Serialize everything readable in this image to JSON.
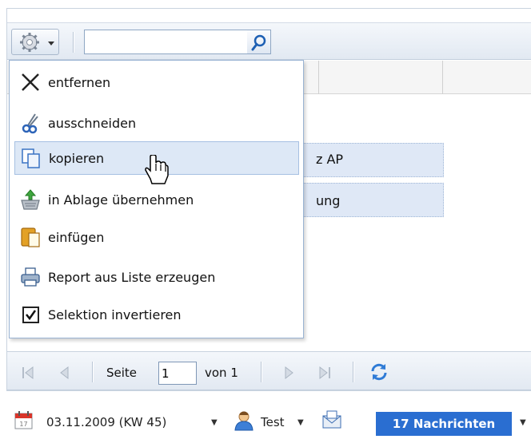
{
  "search": {
    "value": "",
    "placeholder": ""
  },
  "grid": {
    "rows": [
      {
        "text": "z AP"
      },
      {
        "text": "ung"
      }
    ]
  },
  "menu": {
    "items": [
      {
        "label": "entfernen",
        "icon": "close-x-icon"
      },
      {
        "label": "ausschneiden",
        "icon": "scissors-icon"
      },
      {
        "label": "kopieren",
        "icon": "copy-pages-icon"
      },
      {
        "label": "in Ablage übernehmen",
        "icon": "clipboard-tray-icon"
      },
      {
        "label": "einfügen",
        "icon": "paste-icon"
      },
      {
        "label": "Report aus Liste erzeugen",
        "icon": "printer-icon"
      },
      {
        "label": "Selektion invertieren",
        "icon": "checkbox-checked-icon"
      }
    ],
    "hovered_item": "kopieren"
  },
  "pager": {
    "page_label": "Seite",
    "page_value": "1",
    "of_label": "von 1"
  },
  "status": {
    "date": "03.11.2009 (KW 45)",
    "user": "Test",
    "messages": "17 Nachrichten"
  },
  "colors": {
    "accent": "#2a6ed1",
    "selection": "#dfe8f6",
    "hover": "#dde8f6"
  }
}
